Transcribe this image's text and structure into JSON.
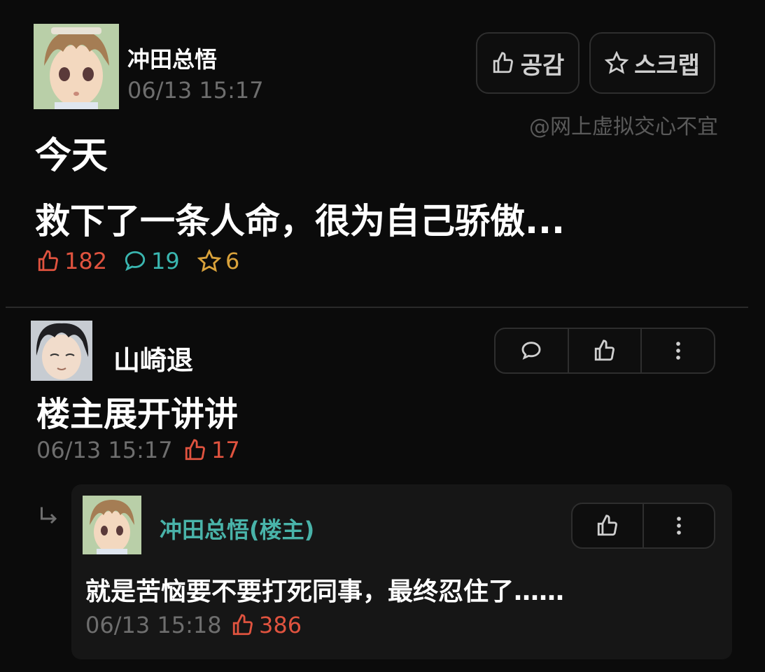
{
  "post": {
    "author": "冲田总悟",
    "time": "06/13 15:17",
    "title": "今天",
    "body": "救下了一条人命，很为自己骄傲...",
    "likes": "182",
    "comments": "19",
    "stars": "6",
    "like_button": "공감",
    "scrap_button": "스크랩",
    "watermark": "@网上虚拟交心不宜"
  },
  "comment": {
    "author": "山崎退",
    "text": "楼主展开讲讲",
    "time": "06/13 15:17",
    "likes": "17"
  },
  "reply": {
    "author": "冲田总悟(楼主)",
    "text": "就是苦恼要不要打死同事，最终忍住了……",
    "time": "06/13 15:18",
    "likes": "386"
  },
  "colors": {
    "like": "#e0533f",
    "comment": "#3ab6b0",
    "star": "#d9a23b",
    "reply_author": "#49b3a9"
  }
}
